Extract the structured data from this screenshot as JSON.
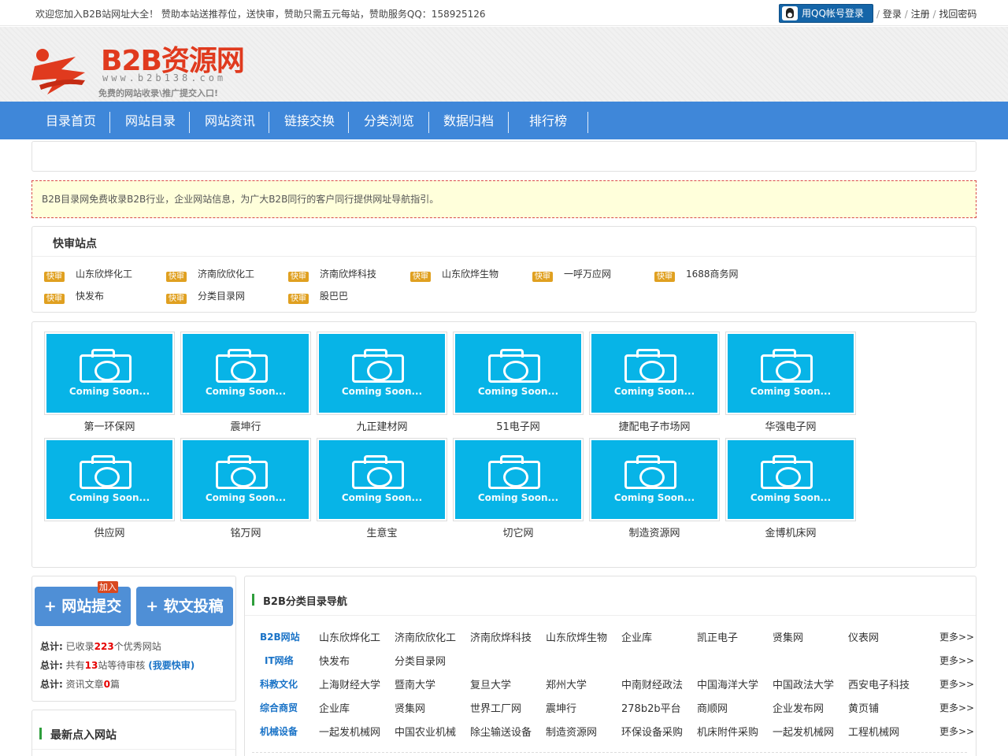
{
  "topbar": {
    "welcome": "欢迎您加入B2B站网址大全！ 赞助本站送推荐位，送快审，赞助只需五元每站，赞助服务QQ：158925126",
    "qq_login": "用QQ帐号登录",
    "login": "登录",
    "register": "注册",
    "find_password": "找回密码",
    "sep": "/"
  },
  "logo": {
    "brand": "B2B资源网",
    "url": "www.b2b138.com",
    "slogan": "免费的网站收录\\推广提交入口!"
  },
  "nav": [
    "目录首页",
    "网站目录",
    "网站资讯",
    "链接交换",
    "分类浏览",
    "数据归档",
    "排行榜"
  ],
  "notice": "B2B目录网免费收录B2B行业，企业网站信息，为广大B2B同行的客户同行提供网址导航指引。",
  "fast": {
    "title": "快审站点",
    "tag": "快审",
    "items": [
      "山东欣烨化工",
      "济南欣欣化工",
      "济南欣烨科技",
      "山东欣烨生物",
      "一呼万应网",
      "1688商务网",
      "快发布",
      "分类目录网",
      "股巴巴"
    ]
  },
  "thumbs": {
    "placeholder": "Coming Soon...",
    "items": [
      "第一环保网",
      "震坤行",
      "九正建材网",
      "51电子网",
      "捷配电子市场网",
      "华强电子网",
      "供应网",
      "铭万网",
      "生意宝",
      "切它网",
      "制造资源网",
      "金博机床网"
    ]
  },
  "sidebar": {
    "submit_site": "+ 网站提交",
    "submit_article": "+ 软文投稿",
    "join": "加入",
    "stats": {
      "label": "总计:",
      "collected_pre": "已收录",
      "collected_num": "223",
      "collected_post": "个优秀网站",
      "pending_pre": "共有",
      "pending_num": "13",
      "pending_post": "站等待审核",
      "pending_link": "(我要快审)",
      "articles_pre": "资讯文章",
      "articles_num": "0",
      "articles_post": "篇"
    },
    "latest_title": "最新点入网站"
  },
  "directory": {
    "title": "B2B分类目录导航",
    "more": "更多>>",
    "rows": [
      {
        "cat": "B2B网站",
        "links": [
          "山东欣烨化工",
          "济南欣欣化工",
          "济南欣烨科技",
          "山东欣烨生物",
          "企业库",
          "凯正电子",
          "贤集网",
          "仪表网"
        ]
      },
      {
        "cat": "IT网络",
        "links": [
          "快发布",
          "分类目录网"
        ]
      },
      {
        "cat": "科教文化",
        "links": [
          "上海财经大学",
          "暨南大学",
          "复旦大学",
          "郑州大学",
          "中南财经政法",
          "中国海洋大学",
          "中国政法大学",
          "西安电子科技"
        ]
      },
      {
        "cat": "综合商贸",
        "links": [
          "企业库",
          "贤集网",
          "世界工厂网",
          "震坤行",
          "278b2b平台",
          "商顺网",
          "企业发布网",
          "黄页铺"
        ]
      },
      {
        "cat": "机械设备",
        "links": [
          "一起发机械网",
          "中国农业机械",
          "除尘输送设备",
          "制造资源网",
          "环保设备采购",
          "机床附件采购",
          "一起发机械网",
          "工程机械网"
        ]
      }
    ]
  },
  "colors": {
    "nav": "#3f87d9",
    "accent_red": "#e03a1e",
    "tile": "#07b4e7",
    "notice_bg": "#ffffdb"
  }
}
